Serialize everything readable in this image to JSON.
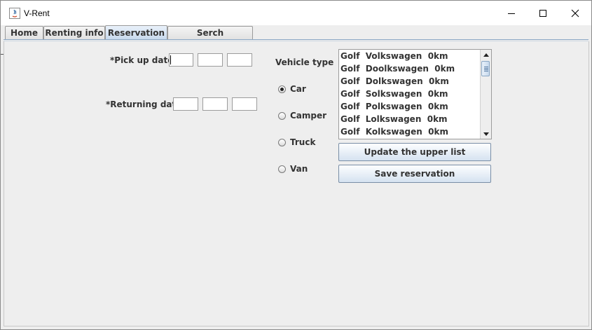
{
  "window": {
    "title": "V-Rent"
  },
  "tabs": [
    {
      "label": "Home"
    },
    {
      "label": "Renting info"
    },
    {
      "label": "Reservation"
    },
    {
      "label": "Serch reservation"
    }
  ],
  "form": {
    "pickup_label": "*Pick up date:",
    "returning_label": "*Returning date:",
    "pickup_fields": [
      "",
      "",
      ""
    ],
    "returning_fields": [
      "",
      "",
      ""
    ]
  },
  "vehicle": {
    "label": "Vehicle type",
    "options": [
      {
        "label": "Car",
        "selected": true
      },
      {
        "label": "Camper",
        "selected": false
      },
      {
        "label": "Truck",
        "selected": false
      },
      {
        "label": "Van",
        "selected": false
      }
    ]
  },
  "list": {
    "items": [
      "Golf  Volkswagen  0km",
      "Golf  Doolkswagen  0km",
      "Golf  Dolkswagen  0km",
      "Golf  Solkswagen  0km",
      "Golf  Polkswagen  0km",
      "Golf  Lolkswagen  0km",
      "Golf  Kolkswagen  0km"
    ]
  },
  "buttons": {
    "update": "Update the upper list",
    "save": "Save reservation"
  }
}
